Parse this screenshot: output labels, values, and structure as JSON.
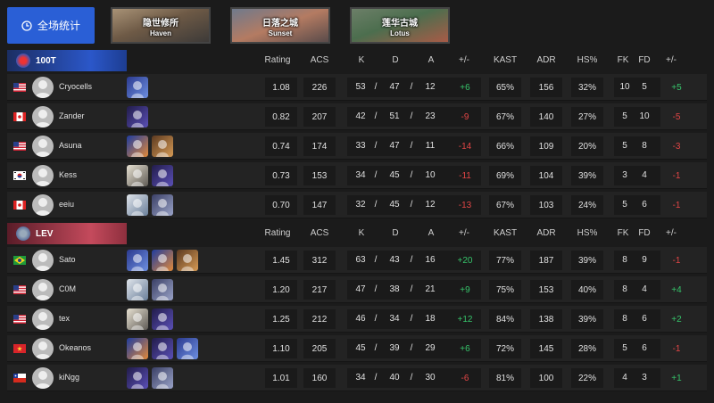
{
  "colors": {
    "accent": "#2a5fd6",
    "positive": "#36c36a",
    "negative": "#e24646",
    "team_a": "#2b57c9",
    "team_b": "#c44a5c"
  },
  "toolbar": {
    "overall_label": "全场统计",
    "overall_icon": "clock-icon"
  },
  "maps": [
    {
      "cn": "隐世修所",
      "en": "Haven"
    },
    {
      "cn": "日落之城",
      "en": "Sunset"
    },
    {
      "cn": "莲华古城",
      "en": "Lotus"
    }
  ],
  "columns": {
    "rating": "Rating",
    "acs": "ACS",
    "k": "K",
    "d": "D",
    "a": "A",
    "pm": "+/-",
    "kast": "KAST",
    "adr": "ADR",
    "hs": "HS%",
    "fk": "FK",
    "fd": "FD",
    "fkpm": "+/-"
  },
  "teams": [
    {
      "name": "100T",
      "players": [
        {
          "flag": "us",
          "name": "Cryocells",
          "agents": [
            "jett"
          ],
          "rating": "1.08",
          "acs": "226",
          "k": "53",
          "d": "47",
          "a": "12",
          "pm": "+6",
          "kast": "65%",
          "adr": "156",
          "hs": "32%",
          "fk": "10",
          "fd": "5",
          "fkpm": "+5"
        },
        {
          "flag": "ca",
          "name": "Zander",
          "agents": [
            "omen"
          ],
          "rating": "0.82",
          "acs": "207",
          "k": "42",
          "d": "51",
          "a": "23",
          "pm": "-9",
          "kast": "67%",
          "adr": "140",
          "hs": "27%",
          "fk": "5",
          "fd": "10",
          "fkpm": "-5"
        },
        {
          "flag": "us",
          "name": "Asuna",
          "agents": [
            "phoenix",
            "breach"
          ],
          "rating": "0.74",
          "acs": "174",
          "k": "33",
          "d": "47",
          "a": "11",
          "pm": "-14",
          "kast": "66%",
          "adr": "109",
          "hs": "20%",
          "fk": "5",
          "fd": "8",
          "fkpm": "-3"
        },
        {
          "flag": "kr",
          "name": "Kess",
          "agents": [
            "cypher",
            "omen"
          ],
          "rating": "0.73",
          "acs": "153",
          "k": "34",
          "d": "45",
          "a": "10",
          "pm": "-11",
          "kast": "69%",
          "adr": "104",
          "hs": "39%",
          "fk": "3",
          "fd": "4",
          "fkpm": "-1"
        },
        {
          "flag": "ca",
          "name": "eeiu",
          "agents": [
            "sage",
            "kayo"
          ],
          "rating": "0.70",
          "acs": "147",
          "k": "32",
          "d": "45",
          "a": "12",
          "pm": "-13",
          "kast": "67%",
          "adr": "103",
          "hs": "24%",
          "fk": "5",
          "fd": "6",
          "fkpm": "-1"
        }
      ]
    },
    {
      "name": "LEV",
      "players": [
        {
          "flag": "br",
          "name": "Sato",
          "agents": [
            "jett",
            "phoenix",
            "breach"
          ],
          "rating": "1.45",
          "acs": "312",
          "k": "63",
          "d": "43",
          "a": "16",
          "pm": "+20",
          "kast": "77%",
          "adr": "187",
          "hs": "39%",
          "fk": "8",
          "fd": "9",
          "fkpm": "-1"
        },
        {
          "flag": "us",
          "name": "C0M",
          "agents": [
            "sage",
            "kayo"
          ],
          "rating": "1.20",
          "acs": "217",
          "k": "47",
          "d": "38",
          "a": "21",
          "pm": "+9",
          "kast": "75%",
          "adr": "153",
          "hs": "40%",
          "fk": "8",
          "fd": "4",
          "fkpm": "+4"
        },
        {
          "flag": "us",
          "name": "tex",
          "agents": [
            "cypher",
            "omen"
          ],
          "rating": "1.25",
          "acs": "212",
          "k": "46",
          "d": "34",
          "a": "18",
          "pm": "+12",
          "kast": "84%",
          "adr": "138",
          "hs": "39%",
          "fk": "8",
          "fd": "6",
          "fkpm": "+2"
        },
        {
          "flag": "vn",
          "name": "Okeanos",
          "agents": [
            "phoenix",
            "omen",
            "jett"
          ],
          "rating": "1.10",
          "acs": "205",
          "k": "45",
          "d": "39",
          "a": "29",
          "pm": "+6",
          "kast": "72%",
          "adr": "145",
          "hs": "28%",
          "fk": "5",
          "fd": "6",
          "fkpm": "-1"
        },
        {
          "flag": "cl",
          "name": "kiNgg",
          "agents": [
            "omen",
            "kayo"
          ],
          "rating": "1.01",
          "acs": "160",
          "k": "34",
          "d": "40",
          "a": "30",
          "pm": "-6",
          "kast": "81%",
          "adr": "100",
          "hs": "22%",
          "fk": "4",
          "fd": "3",
          "fkpm": "+1"
        }
      ]
    }
  ]
}
